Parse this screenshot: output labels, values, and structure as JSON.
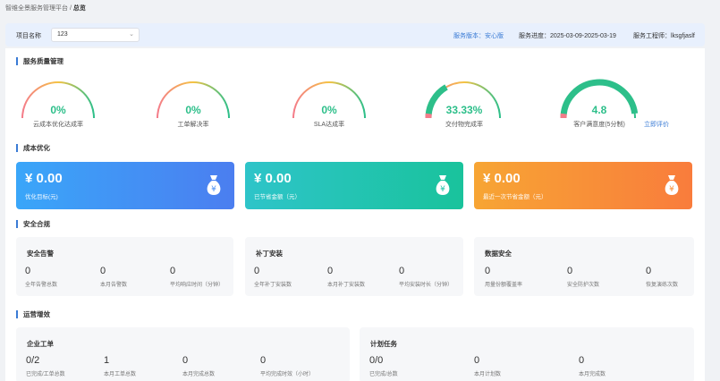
{
  "breadcrumb": {
    "root": "智维全景服务管理平台",
    "sep": "/",
    "current": "总览"
  },
  "filter": {
    "project_label": "项目名称",
    "project_value": "123",
    "service_version_label": "服务版本：",
    "service_version_value": "安心版",
    "service_progress_label": "服务进度：",
    "service_progress_value": "2025-03-09-2025-03-19",
    "engineer_label": "服务工程师：",
    "engineer_value": "lksgfjaslf"
  },
  "sections": {
    "quality": "服务质量管理",
    "cost": "成本优化",
    "security": "安全合规",
    "ops": "运营增效"
  },
  "gauges": [
    {
      "value": "0%",
      "label": "云成本优化达成率",
      "level": 0
    },
    {
      "value": "0%",
      "label": "工单解决率",
      "level": 0
    },
    {
      "value": "0%",
      "label": "SLA达成率",
      "level": 0
    },
    {
      "value": "33.33%",
      "label": "交付物完成率",
      "level": 0.3333
    },
    {
      "value": "4.8",
      "label": "客户满意度(5分制)",
      "level": 0.96
    }
  ],
  "eval_link": "立即评价",
  "cost_cards": [
    {
      "amount": "¥ 0.00",
      "desc": "优化目标(元)"
    },
    {
      "amount": "¥ 0.00",
      "desc": "已节省金额（元）"
    },
    {
      "amount": "¥ 0.00",
      "desc": "最近一次节省金额（元）"
    }
  ],
  "security_panels": [
    {
      "title": "安全告警",
      "stats": [
        {
          "num": "0",
          "cap": "全年告警总数"
        },
        {
          "num": "0",
          "cap": "本月告警数"
        },
        {
          "num": "0",
          "cap": "平均响应时间（分钟）"
        }
      ]
    },
    {
      "title": "补丁安装",
      "stats": [
        {
          "num": "0",
          "cap": "全年补丁安装数"
        },
        {
          "num": "0",
          "cap": "本月补丁安装数"
        },
        {
          "num": "0",
          "cap": "平均安装时长（分钟）"
        }
      ]
    },
    {
      "title": "数据安全",
      "stats": [
        {
          "num": "0",
          "cap": "用量份额覆盖率"
        },
        {
          "num": "0",
          "cap": "安全防护次数"
        },
        {
          "num": "0",
          "cap": "恢复演练次数"
        }
      ]
    }
  ],
  "ops_panels": [
    {
      "title": "企业工单",
      "stats": [
        {
          "num": "0/2",
          "cap": "已完成/工单总数"
        },
        {
          "num": "1",
          "cap": "本月工单总数"
        },
        {
          "num": "0",
          "cap": "本月完成总数"
        },
        {
          "num": "0",
          "cap": "平均完成时效（小时）"
        }
      ]
    },
    {
      "title": "计划任务",
      "stats": [
        {
          "num": "0/0",
          "cap": "已完成/总数"
        },
        {
          "num": "0",
          "cap": "本月计划数"
        },
        {
          "num": "0",
          "cap": "本月完成数"
        }
      ]
    }
  ],
  "colors": {
    "accent": "#3a7bd5",
    "gauge_green": "#2dbf8a",
    "gauge_track_start": "#f47c8a",
    "gauge_track_end": "#f5c242"
  }
}
